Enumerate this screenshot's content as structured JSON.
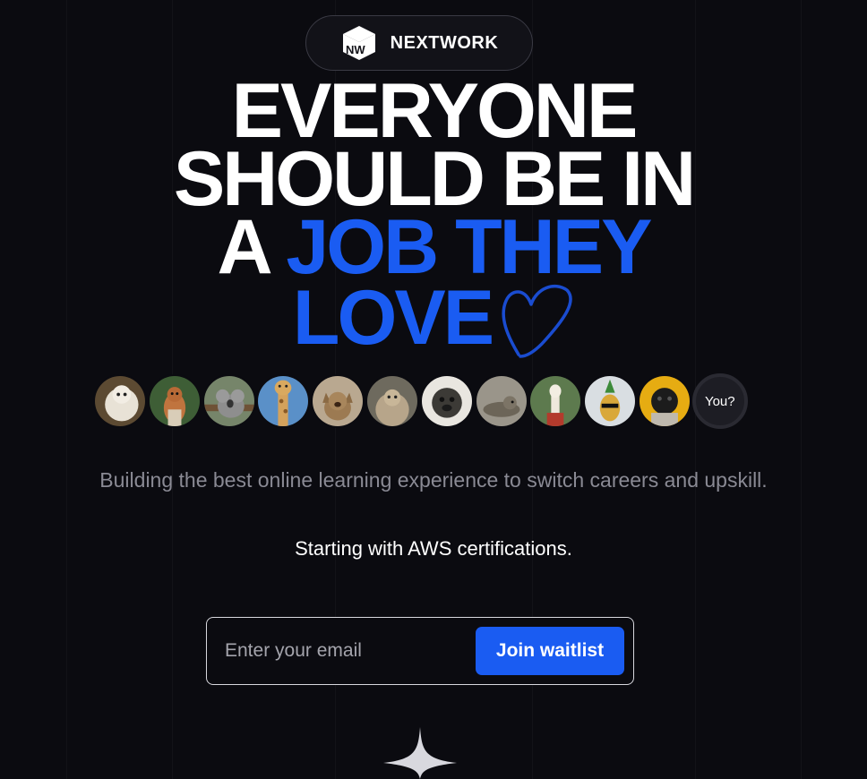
{
  "brand": {
    "name": "NEXTWORK",
    "logo_letters": "NW",
    "logo_icon": "cube-logo-icon"
  },
  "headline": {
    "line1": "EVERYONE",
    "line2": "SHOULD BE IN",
    "line3_plain": "A ",
    "line3_accent": "JOB THEY",
    "line4_accent": "LOVE",
    "heart_icon": "heart-icon"
  },
  "avatars": {
    "items": [
      {
        "name": "fluffy-dog-avatar"
      },
      {
        "name": "squirrel-avatar"
      },
      {
        "name": "koala-avatar"
      },
      {
        "name": "giraffe-avatar"
      },
      {
        "name": "cat-avatar"
      },
      {
        "name": "blanket-dog-avatar"
      },
      {
        "name": "pug-avatar"
      },
      {
        "name": "seal-avatar"
      },
      {
        "name": "llama-avatar"
      },
      {
        "name": "pineapple-avatar"
      },
      {
        "name": "black-pug-avatar"
      }
    ],
    "you_label": "You?"
  },
  "subtitle": "Building the best online learning experience to switch careers and upskill.",
  "subtitle_strong": "Starting with AWS certifications.",
  "waitlist": {
    "email_placeholder": "Enter your email",
    "join_label": "Join waitlist"
  },
  "colors": {
    "background": "#0b0b10",
    "accent": "#1a5cf2",
    "text": "#ffffff",
    "muted": "#8a8a94"
  },
  "decor": {
    "sparkle_icon": "sparkle-icon"
  }
}
